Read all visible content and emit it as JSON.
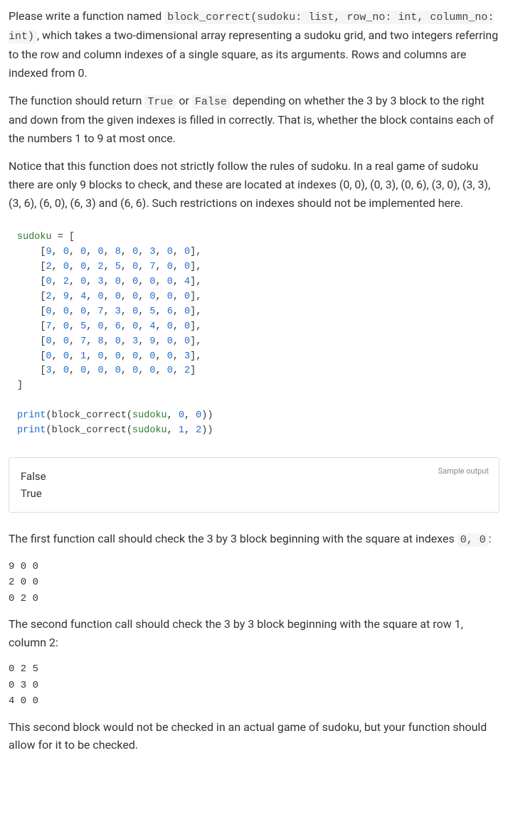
{
  "para1_pre": "Please write a function named ",
  "para1_code": "block_correct(sudoku: list, row_no: int, column_no: int)",
  "para1_post": ", which takes a two-dimensional array representing a sudoku grid, and two integers referring to the row and column indexes of a single square, as its arguments. Rows and columns are indexed from 0.",
  "para2_pre": "The function should return ",
  "para2_true": "True",
  "para2_mid": " or ",
  "para2_false": "False",
  "para2_post": " depending on whether the 3 by 3 block to the right and down from the given indexes is filled in correctly. That is, whether the block contains each of the numbers 1 to 9 at most once.",
  "para3": "Notice that this function does not strictly follow the rules of sudoku. In a real game of sudoku there are only 9 blocks to check, and these are located at indexes (0, 0), (0, 3), (0, 6), (3, 0), (3, 3), (3, 6), (6, 0), (6, 3) and (6, 6). Such restrictions on indexes should not be implemented here.",
  "code": {
    "l0a": "sudoku ",
    "l0b": "=",
    "l0c": " [",
    "rows": [
      "[9, 0, 0, 0, 8, 0, 3, 0, 0],",
      "[2, 0, 0, 2, 5, 0, 7, 0, 0],",
      "[0, 2, 0, 3, 0, 0, 0, 0, 4],",
      "[2, 9, 4, 0, 0, 0, 0, 0, 0],",
      "[0, 0, 0, 7, 3, 0, 5, 6, 0],",
      "[7, 0, 5, 0, 6, 0, 4, 0, 0],",
      "[0, 0, 7, 8, 0, 3, 9, 0, 0],",
      "[0, 0, 1, 0, 0, 0, 0, 0, 3],",
      "[3, 0, 0, 0, 0, 0, 0, 0, 2]"
    ],
    "close": "]",
    "p1": "print(block_correct(sudoku, 0, 0))",
    "p2": "print(block_correct(sudoku, 1, 2))"
  },
  "sample_label": "Sample output",
  "sample_out": "False\nTrue",
  "para4_pre": "The first function call should check the 3 by 3 block beginning with the square at indexes ",
  "para4_code": "0, 0",
  "para4_post": ":",
  "block1": "9 0 0\n2 0 0\n0 2 0",
  "para5": "The second function call should check the 3 by 3 block beginning with the square at row 1, column 2:",
  "block2": "0 2 5\n0 3 0\n4 0 0",
  "para6": "This second block would not be checked in an actual game of sudoku, but your function should allow for it to be checked."
}
